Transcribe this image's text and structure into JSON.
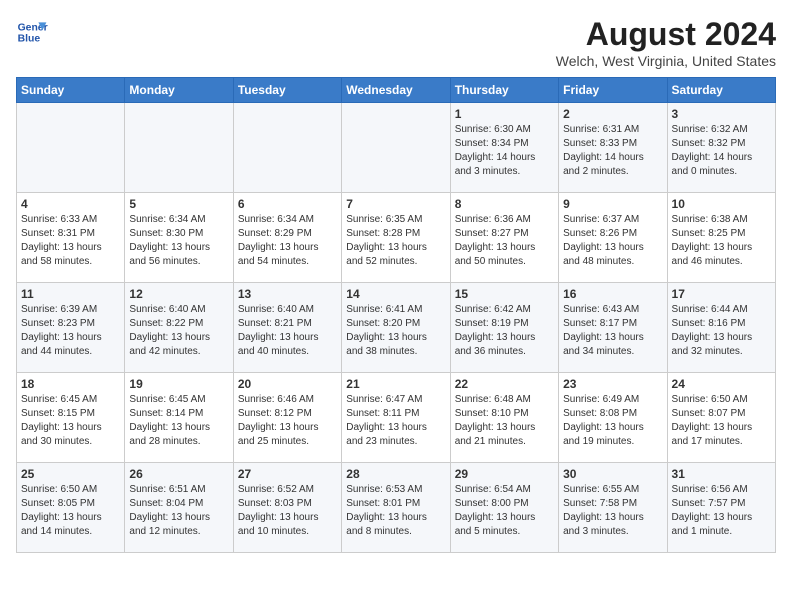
{
  "header": {
    "logo_line1": "General",
    "logo_line2": "Blue",
    "title": "August 2024",
    "subtitle": "Welch, West Virginia, United States"
  },
  "days_of_week": [
    "Sunday",
    "Monday",
    "Tuesday",
    "Wednesday",
    "Thursday",
    "Friday",
    "Saturday"
  ],
  "weeks": [
    [
      {
        "day": "",
        "info": ""
      },
      {
        "day": "",
        "info": ""
      },
      {
        "day": "",
        "info": ""
      },
      {
        "day": "",
        "info": ""
      },
      {
        "day": "1",
        "info": "Sunrise: 6:30 AM\nSunset: 8:34 PM\nDaylight: 14 hours\nand 3 minutes."
      },
      {
        "day": "2",
        "info": "Sunrise: 6:31 AM\nSunset: 8:33 PM\nDaylight: 14 hours\nand 2 minutes."
      },
      {
        "day": "3",
        "info": "Sunrise: 6:32 AM\nSunset: 8:32 PM\nDaylight: 14 hours\nand 0 minutes."
      }
    ],
    [
      {
        "day": "4",
        "info": "Sunrise: 6:33 AM\nSunset: 8:31 PM\nDaylight: 13 hours\nand 58 minutes."
      },
      {
        "day": "5",
        "info": "Sunrise: 6:34 AM\nSunset: 8:30 PM\nDaylight: 13 hours\nand 56 minutes."
      },
      {
        "day": "6",
        "info": "Sunrise: 6:34 AM\nSunset: 8:29 PM\nDaylight: 13 hours\nand 54 minutes."
      },
      {
        "day": "7",
        "info": "Sunrise: 6:35 AM\nSunset: 8:28 PM\nDaylight: 13 hours\nand 52 minutes."
      },
      {
        "day": "8",
        "info": "Sunrise: 6:36 AM\nSunset: 8:27 PM\nDaylight: 13 hours\nand 50 minutes."
      },
      {
        "day": "9",
        "info": "Sunrise: 6:37 AM\nSunset: 8:26 PM\nDaylight: 13 hours\nand 48 minutes."
      },
      {
        "day": "10",
        "info": "Sunrise: 6:38 AM\nSunset: 8:25 PM\nDaylight: 13 hours\nand 46 minutes."
      }
    ],
    [
      {
        "day": "11",
        "info": "Sunrise: 6:39 AM\nSunset: 8:23 PM\nDaylight: 13 hours\nand 44 minutes."
      },
      {
        "day": "12",
        "info": "Sunrise: 6:40 AM\nSunset: 8:22 PM\nDaylight: 13 hours\nand 42 minutes."
      },
      {
        "day": "13",
        "info": "Sunrise: 6:40 AM\nSunset: 8:21 PM\nDaylight: 13 hours\nand 40 minutes."
      },
      {
        "day": "14",
        "info": "Sunrise: 6:41 AM\nSunset: 8:20 PM\nDaylight: 13 hours\nand 38 minutes."
      },
      {
        "day": "15",
        "info": "Sunrise: 6:42 AM\nSunset: 8:19 PM\nDaylight: 13 hours\nand 36 minutes."
      },
      {
        "day": "16",
        "info": "Sunrise: 6:43 AM\nSunset: 8:17 PM\nDaylight: 13 hours\nand 34 minutes."
      },
      {
        "day": "17",
        "info": "Sunrise: 6:44 AM\nSunset: 8:16 PM\nDaylight: 13 hours\nand 32 minutes."
      }
    ],
    [
      {
        "day": "18",
        "info": "Sunrise: 6:45 AM\nSunset: 8:15 PM\nDaylight: 13 hours\nand 30 minutes."
      },
      {
        "day": "19",
        "info": "Sunrise: 6:45 AM\nSunset: 8:14 PM\nDaylight: 13 hours\nand 28 minutes."
      },
      {
        "day": "20",
        "info": "Sunrise: 6:46 AM\nSunset: 8:12 PM\nDaylight: 13 hours\nand 25 minutes."
      },
      {
        "day": "21",
        "info": "Sunrise: 6:47 AM\nSunset: 8:11 PM\nDaylight: 13 hours\nand 23 minutes."
      },
      {
        "day": "22",
        "info": "Sunrise: 6:48 AM\nSunset: 8:10 PM\nDaylight: 13 hours\nand 21 minutes."
      },
      {
        "day": "23",
        "info": "Sunrise: 6:49 AM\nSunset: 8:08 PM\nDaylight: 13 hours\nand 19 minutes."
      },
      {
        "day": "24",
        "info": "Sunrise: 6:50 AM\nSunset: 8:07 PM\nDaylight: 13 hours\nand 17 minutes."
      }
    ],
    [
      {
        "day": "25",
        "info": "Sunrise: 6:50 AM\nSunset: 8:05 PM\nDaylight: 13 hours\nand 14 minutes."
      },
      {
        "day": "26",
        "info": "Sunrise: 6:51 AM\nSunset: 8:04 PM\nDaylight: 13 hours\nand 12 minutes."
      },
      {
        "day": "27",
        "info": "Sunrise: 6:52 AM\nSunset: 8:03 PM\nDaylight: 13 hours\nand 10 minutes."
      },
      {
        "day": "28",
        "info": "Sunrise: 6:53 AM\nSunset: 8:01 PM\nDaylight: 13 hours\nand 8 minutes."
      },
      {
        "day": "29",
        "info": "Sunrise: 6:54 AM\nSunset: 8:00 PM\nDaylight: 13 hours\nand 5 minutes."
      },
      {
        "day": "30",
        "info": "Sunrise: 6:55 AM\nSunset: 7:58 PM\nDaylight: 13 hours\nand 3 minutes."
      },
      {
        "day": "31",
        "info": "Sunrise: 6:56 AM\nSunset: 7:57 PM\nDaylight: 13 hours\nand 1 minute."
      }
    ]
  ]
}
